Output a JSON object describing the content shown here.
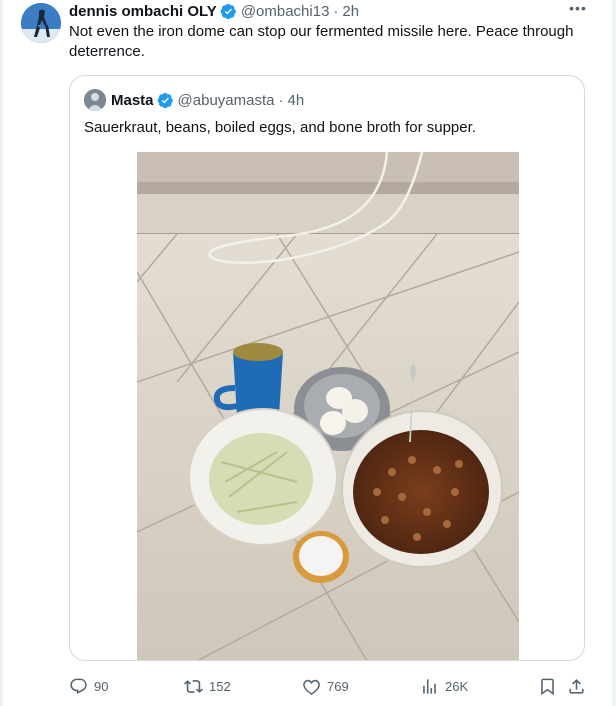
{
  "post": {
    "author_name": "dennis ombachi OLY",
    "author_handle": "@ombachi13",
    "time": "2h",
    "text": "Not even the iron dome can stop our fermented missile here. Peace through deterrence.",
    "more_icon": "more-horizontal-icon"
  },
  "quote": {
    "author_name": "Masta",
    "author_handle": "@abuyamasta",
    "time": "4h",
    "text": "Sauerkraut, beans, boiled eggs, and bone broth for supper."
  },
  "actions": {
    "replies": "90",
    "reposts": "152",
    "likes": "769",
    "views": "26K",
    "icons": [
      "reply-icon",
      "repost-icon",
      "like-icon",
      "views-icon",
      "bookmark-icon",
      "share-icon"
    ]
  },
  "colors": {
    "text": "#0f1419",
    "secondary": "#536471",
    "verified": "#1d9bf0",
    "border": "#cfd9de"
  }
}
